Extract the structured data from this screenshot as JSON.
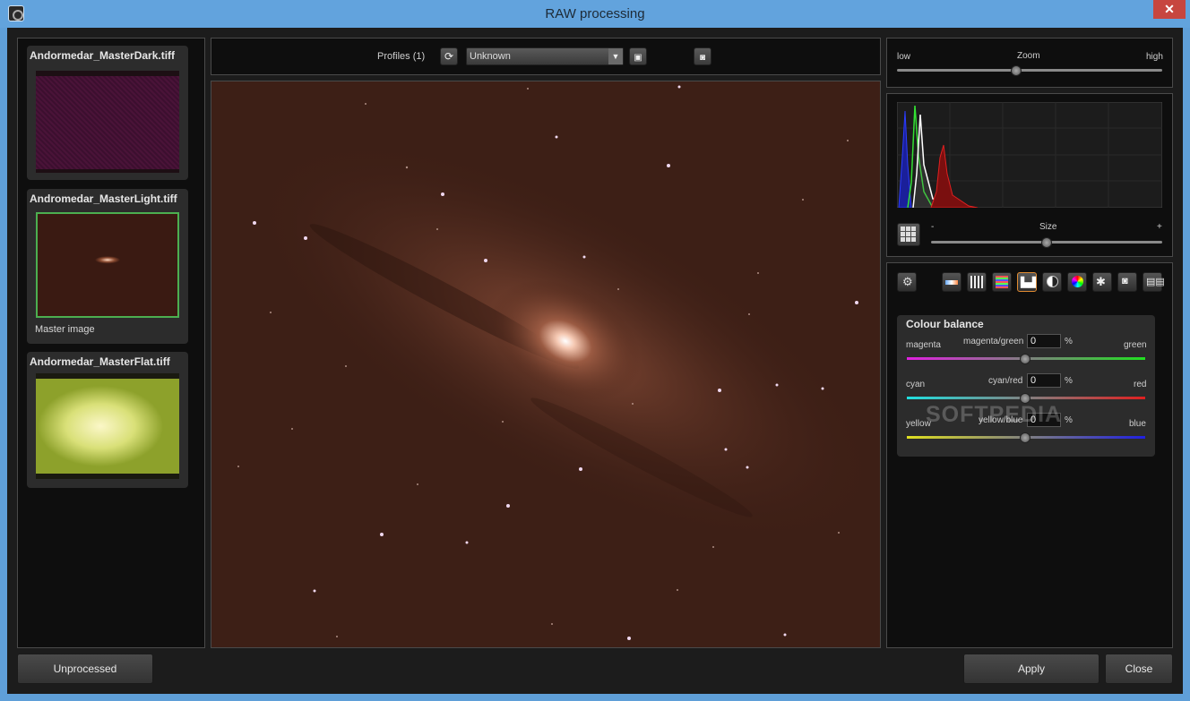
{
  "window": {
    "title": "RAW processing",
    "close_label": "✕"
  },
  "thumbnails": [
    {
      "name": "Andormedar_MasterDark.tiff",
      "caption": ""
    },
    {
      "name": "Andromedar_MasterLight.tiff",
      "caption": "Master image"
    },
    {
      "name": "Andormedar_MasterFlat.tiff",
      "caption": ""
    }
  ],
  "toolbar": {
    "profiles_label": "Profiles (1)",
    "profile_value": "Unknown"
  },
  "zoom": {
    "low_label": "low",
    "title": "Zoom",
    "high_label": "high",
    "level": 0.45
  },
  "histogram": {
    "size_minus": "-",
    "size_title": "Size",
    "size_plus": "+",
    "size_level": 0.5
  },
  "colour_balance": {
    "title": "Colour balance",
    "rows": [
      {
        "left": "magenta",
        "center": "magenta/green",
        "value": "0",
        "unit": "%",
        "right": "green"
      },
      {
        "left": "cyan",
        "center": "cyan/red",
        "value": "0",
        "unit": "%",
        "right": "red"
      },
      {
        "left": "yellow",
        "center": "yellow/blue",
        "value": "0",
        "unit": "%",
        "right": "blue"
      }
    ]
  },
  "watermark": "SOFTPEDIA",
  "footer": {
    "unprocessed_label": "Unprocessed",
    "apply_label": "Apply",
    "close_label": "Close"
  },
  "colors": {
    "accent": "#5f9fd8",
    "selection": "#4caf50"
  }
}
